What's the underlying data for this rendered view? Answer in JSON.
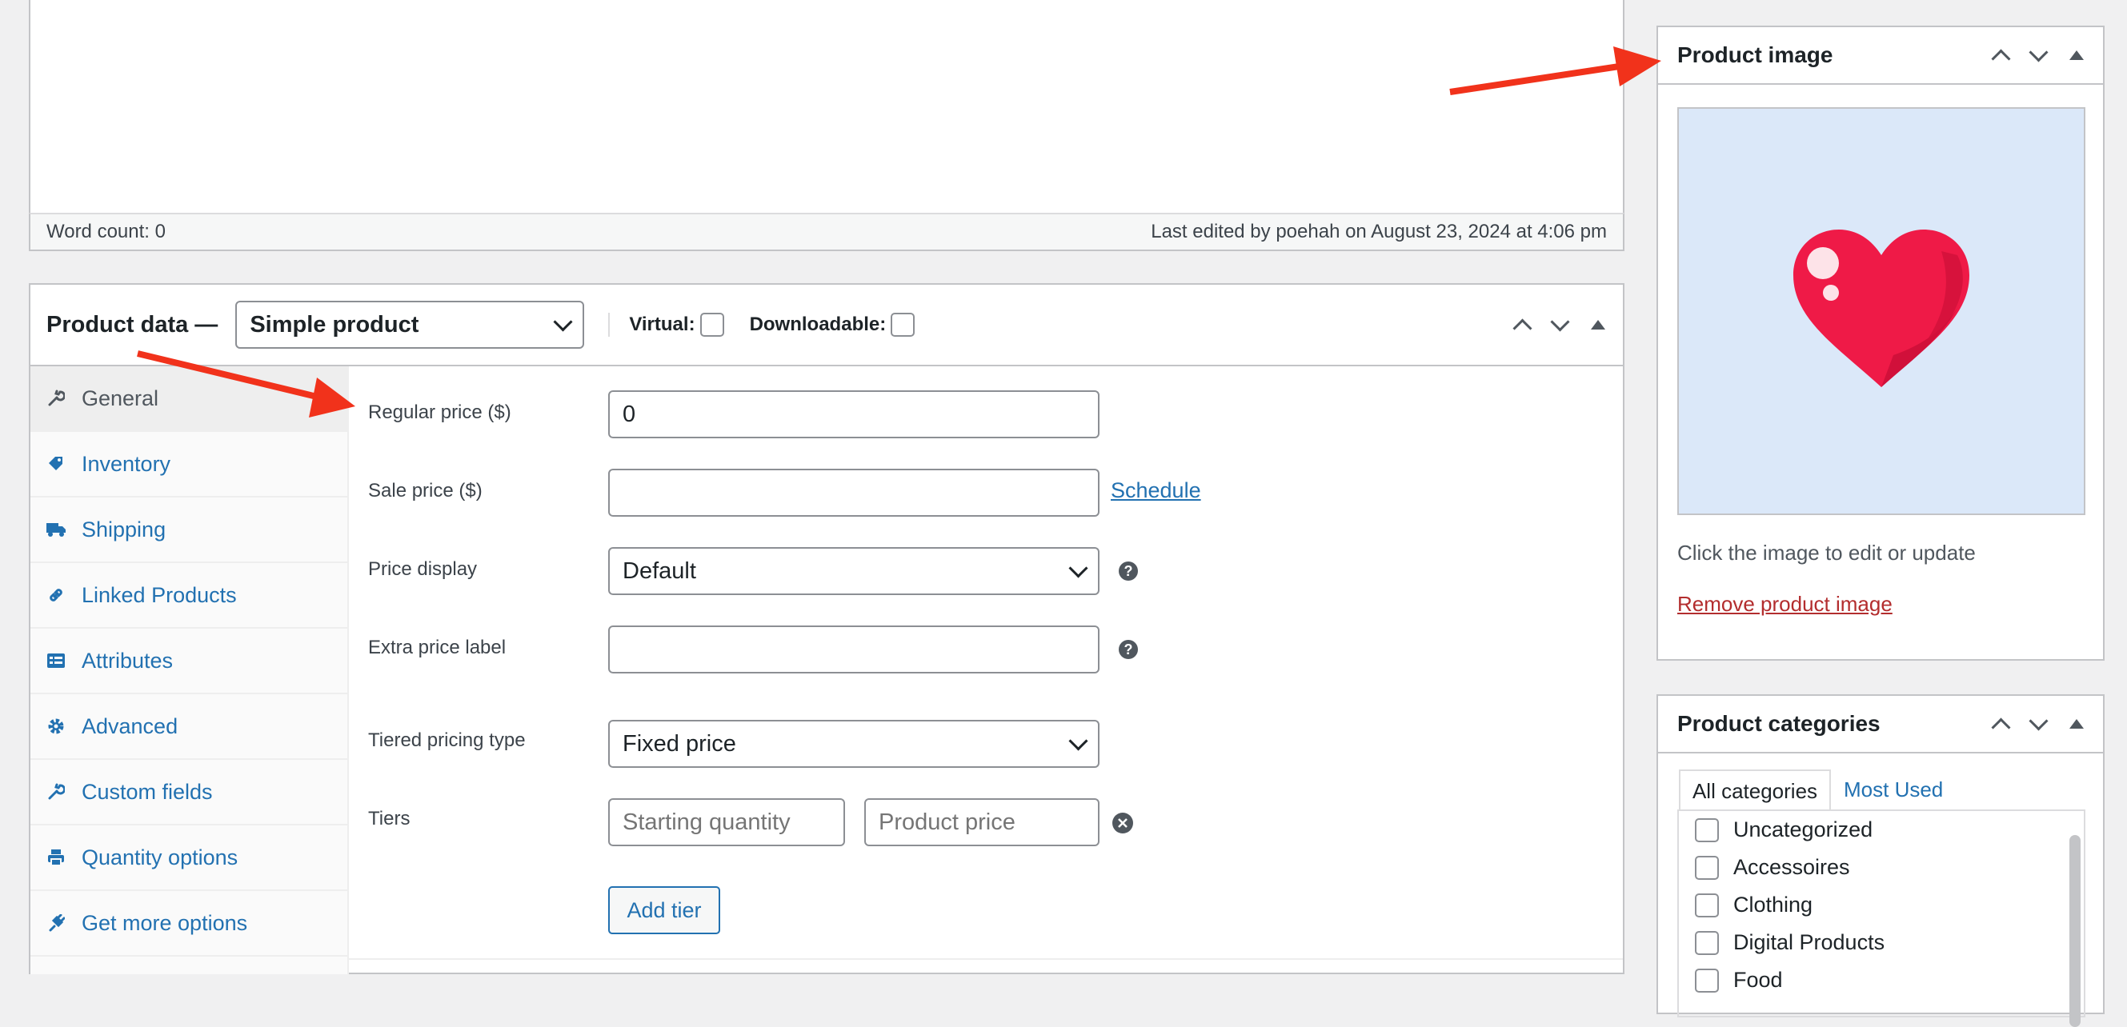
{
  "editor": {
    "word_count": "Word count: 0",
    "last_edited": "Last edited by poehah on August 23, 2024 at 4:06 pm"
  },
  "product_data": {
    "title": "Product data —",
    "type_select": "Simple product",
    "virtual_label": "Virtual:",
    "downloadable_label": "Downloadable:",
    "tabs": [
      {
        "label": "General",
        "icon": "wrench-icon"
      },
      {
        "label": "Inventory",
        "icon": "tag-icon"
      },
      {
        "label": "Shipping",
        "icon": "truck-icon"
      },
      {
        "label": "Linked Products",
        "icon": "link-icon"
      },
      {
        "label": "Attributes",
        "icon": "list-icon"
      },
      {
        "label": "Advanced",
        "icon": "gear-icon"
      },
      {
        "label": "Custom fields",
        "icon": "wrench-icon"
      },
      {
        "label": "Quantity options",
        "icon": "printer-icon"
      },
      {
        "label": "Get more options",
        "icon": "plugin-icon"
      }
    ],
    "fields": {
      "regular_price_label": "Regular price ($)",
      "regular_price_value": "0",
      "sale_price_label": "Sale price ($)",
      "sale_price_value": "",
      "schedule_link": "Schedule",
      "price_display_label": "Price display",
      "price_display_value": "Default",
      "extra_price_label": "Extra price label",
      "extra_price_value": "",
      "tiered_pricing_label": "Tiered pricing type",
      "tiered_pricing_value": "Fixed price",
      "tiers_label": "Tiers",
      "starting_quantity_placeholder": "Starting quantity",
      "product_price_placeholder": "Product price",
      "add_tier_button": "Add tier"
    }
  },
  "product_image": {
    "title": "Product image",
    "hint": "Click the image to edit or update",
    "remove_link": "Remove product image",
    "image_bg": "#dbe8f9",
    "heart_color": "#ef1a47"
  },
  "product_categories": {
    "title": "Product categories",
    "tabs": [
      "All categories",
      "Most Used"
    ],
    "items": [
      "Uncategorized",
      "Accessoires",
      "Clothing",
      "Digital Products",
      "Food"
    ]
  },
  "colors": {
    "link": "#2271b1",
    "arrow": "#f1321b",
    "remove": "#b32d2e"
  }
}
